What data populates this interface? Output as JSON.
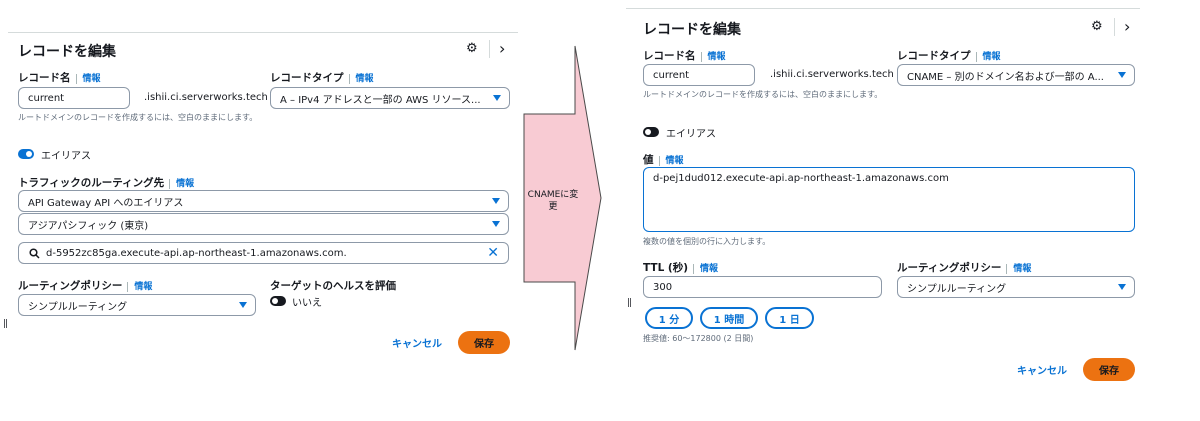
{
  "left": {
    "title": "レコードを編集",
    "record_name": {
      "label": "レコード名",
      "info": "情報",
      "value": "current",
      "suffix": ".ishii.ci.serverworks.tech",
      "hint": "ルートドメインのレコードを作成するには、空白のままにします。"
    },
    "record_type": {
      "label": "レコードタイプ",
      "info": "情報",
      "value": "A – IPv4 アドレスと一部の AWS リソース..."
    },
    "alias": {
      "label": "エイリアス",
      "on": true
    },
    "routing_target": {
      "label": "トラフィックのルーティング先",
      "info": "情報",
      "endpoint": "API Gateway API へのエイリアス",
      "region": "アジアパシフィック (東京)",
      "search_value": "d-5952zc85ga.execute-api.ap-northeast-1.amazonaws.com."
    },
    "routing_policy": {
      "label": "ルーティングポリシー",
      "info": "情報",
      "value": "シンプルルーティング"
    },
    "health": {
      "label": "ターゲットのヘルスを評価",
      "toggle_label": "いいえ",
      "on": false
    },
    "cancel": "キャンセル",
    "save": "保存"
  },
  "arrow": {
    "text": "CNAMEに変更"
  },
  "right": {
    "title": "レコードを編集",
    "record_name": {
      "label": "レコード名",
      "info": "情報",
      "value": "current",
      "suffix": ".ishii.ci.serverworks.tech",
      "hint": "ルートドメインのレコードを作成するには、空白のままにします。"
    },
    "record_type": {
      "label": "レコードタイプ",
      "info": "情報",
      "value": "CNAME – 別のドメイン名および一部の A..."
    },
    "alias": {
      "label": "エイリアス",
      "on": false
    },
    "value": {
      "label": "値",
      "info": "情報",
      "text": "d-pej1dud012.execute-api.ap-northeast-1.amazonaws.com",
      "hint": "複数の値を個別の行に入力します。"
    },
    "ttl": {
      "label": "TTL (秒)",
      "info": "情報",
      "value": "300",
      "presets": [
        "1 分",
        "1 時間",
        "1 日"
      ],
      "hint": "推奨値: 60〜172800 (2 日間)"
    },
    "routing_policy": {
      "label": "ルーティングポリシー",
      "info": "情報",
      "value": "シンプルルーティング"
    },
    "cancel": "キャンセル",
    "save": "保存"
  },
  "colors": {
    "accent": "#0972d3",
    "primary_button": "#ec7211",
    "arrow_fill": "#f8cbd3",
    "toggle_off": "#16191f"
  }
}
